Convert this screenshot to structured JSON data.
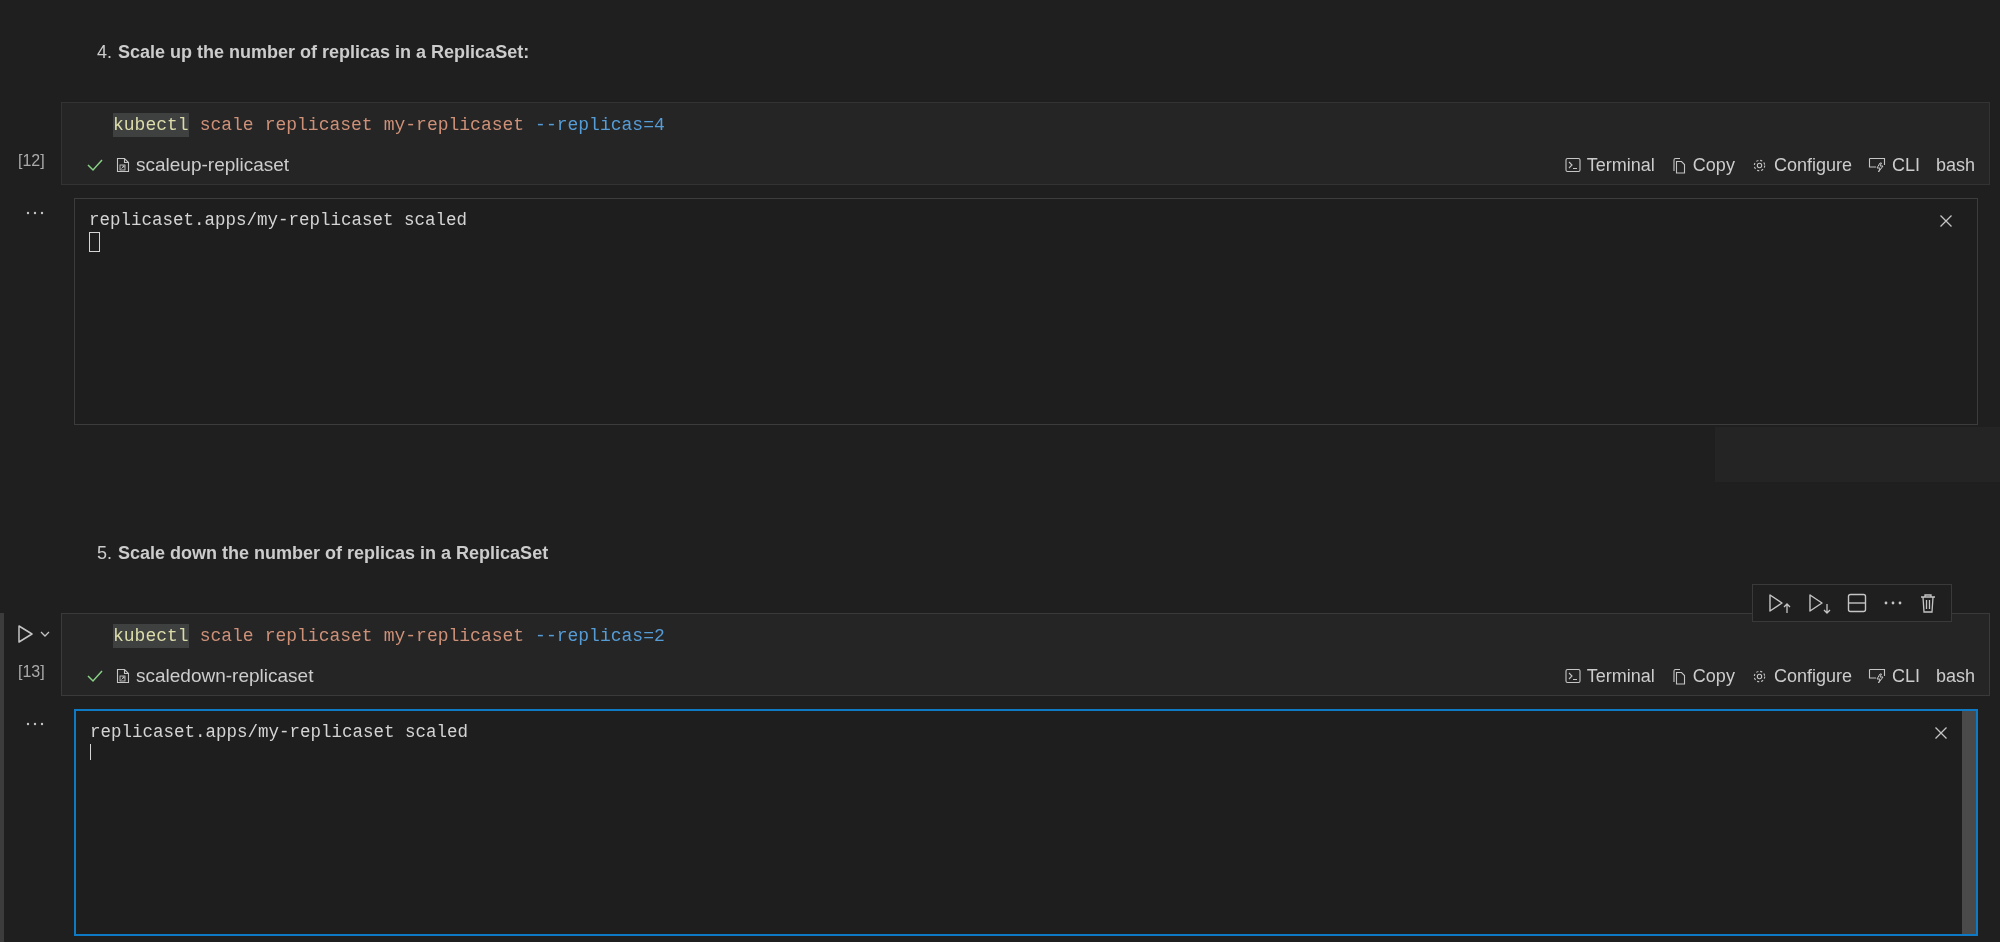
{
  "sections": [
    {
      "number": "4.",
      "heading": "Scale up the number of replicas in a ReplicaSet:",
      "cell": {
        "selected": false,
        "execution_count": "[12]",
        "succeeded": true,
        "name": "scaleup-replicaset",
        "code": [
          {
            "text": "kubectl",
            "kind": "command",
            "highlighted": true
          },
          {
            "text": "scale",
            "kind": "arg",
            "highlighted": false
          },
          {
            "text": "replicaset",
            "kind": "arg",
            "highlighted": false
          },
          {
            "text": "my-replicaset",
            "kind": "arg",
            "highlighted": false
          },
          {
            "text": "--replicas=4",
            "kind": "flag",
            "highlighted": false
          }
        ],
        "actions": [
          {
            "label": "Terminal",
            "kind": "terminal"
          },
          {
            "label": "Copy",
            "kind": "copy"
          },
          {
            "label": "Configure",
            "kind": "configure"
          },
          {
            "label": "CLI",
            "kind": "cli"
          },
          {
            "label": "bash",
            "kind": "language"
          }
        ],
        "output": {
          "lines": [
            "replicaset.apps/my-replicaset scaled"
          ],
          "focused": false,
          "block_cursor": true
        }
      }
    },
    {
      "number": "5.",
      "heading": "Scale down the number of replicas in a ReplicaSet",
      "cell": {
        "selected": true,
        "execution_count": "[13]",
        "succeeded": true,
        "name": "scaledown-replicaset",
        "code": [
          {
            "text": "kubectl",
            "kind": "command",
            "highlighted": true
          },
          {
            "text": "scale",
            "kind": "arg",
            "highlighted": false
          },
          {
            "text": "replicaset",
            "kind": "arg",
            "highlighted": false
          },
          {
            "text": "my-replicaset",
            "kind": "arg",
            "highlighted": false
          },
          {
            "text": "--replicas=2",
            "kind": "flag",
            "highlighted": false
          }
        ],
        "actions": [
          {
            "label": "Terminal",
            "kind": "terminal"
          },
          {
            "label": "Copy",
            "kind": "copy"
          },
          {
            "label": "Configure",
            "kind": "configure"
          },
          {
            "label": "CLI",
            "kind": "cli"
          },
          {
            "label": "bash",
            "kind": "language"
          }
        ],
        "output": {
          "lines": [
            "replicaset.apps/my-replicaset scaled"
          ],
          "focused": true,
          "block_cursor": false
        }
      }
    }
  ]
}
